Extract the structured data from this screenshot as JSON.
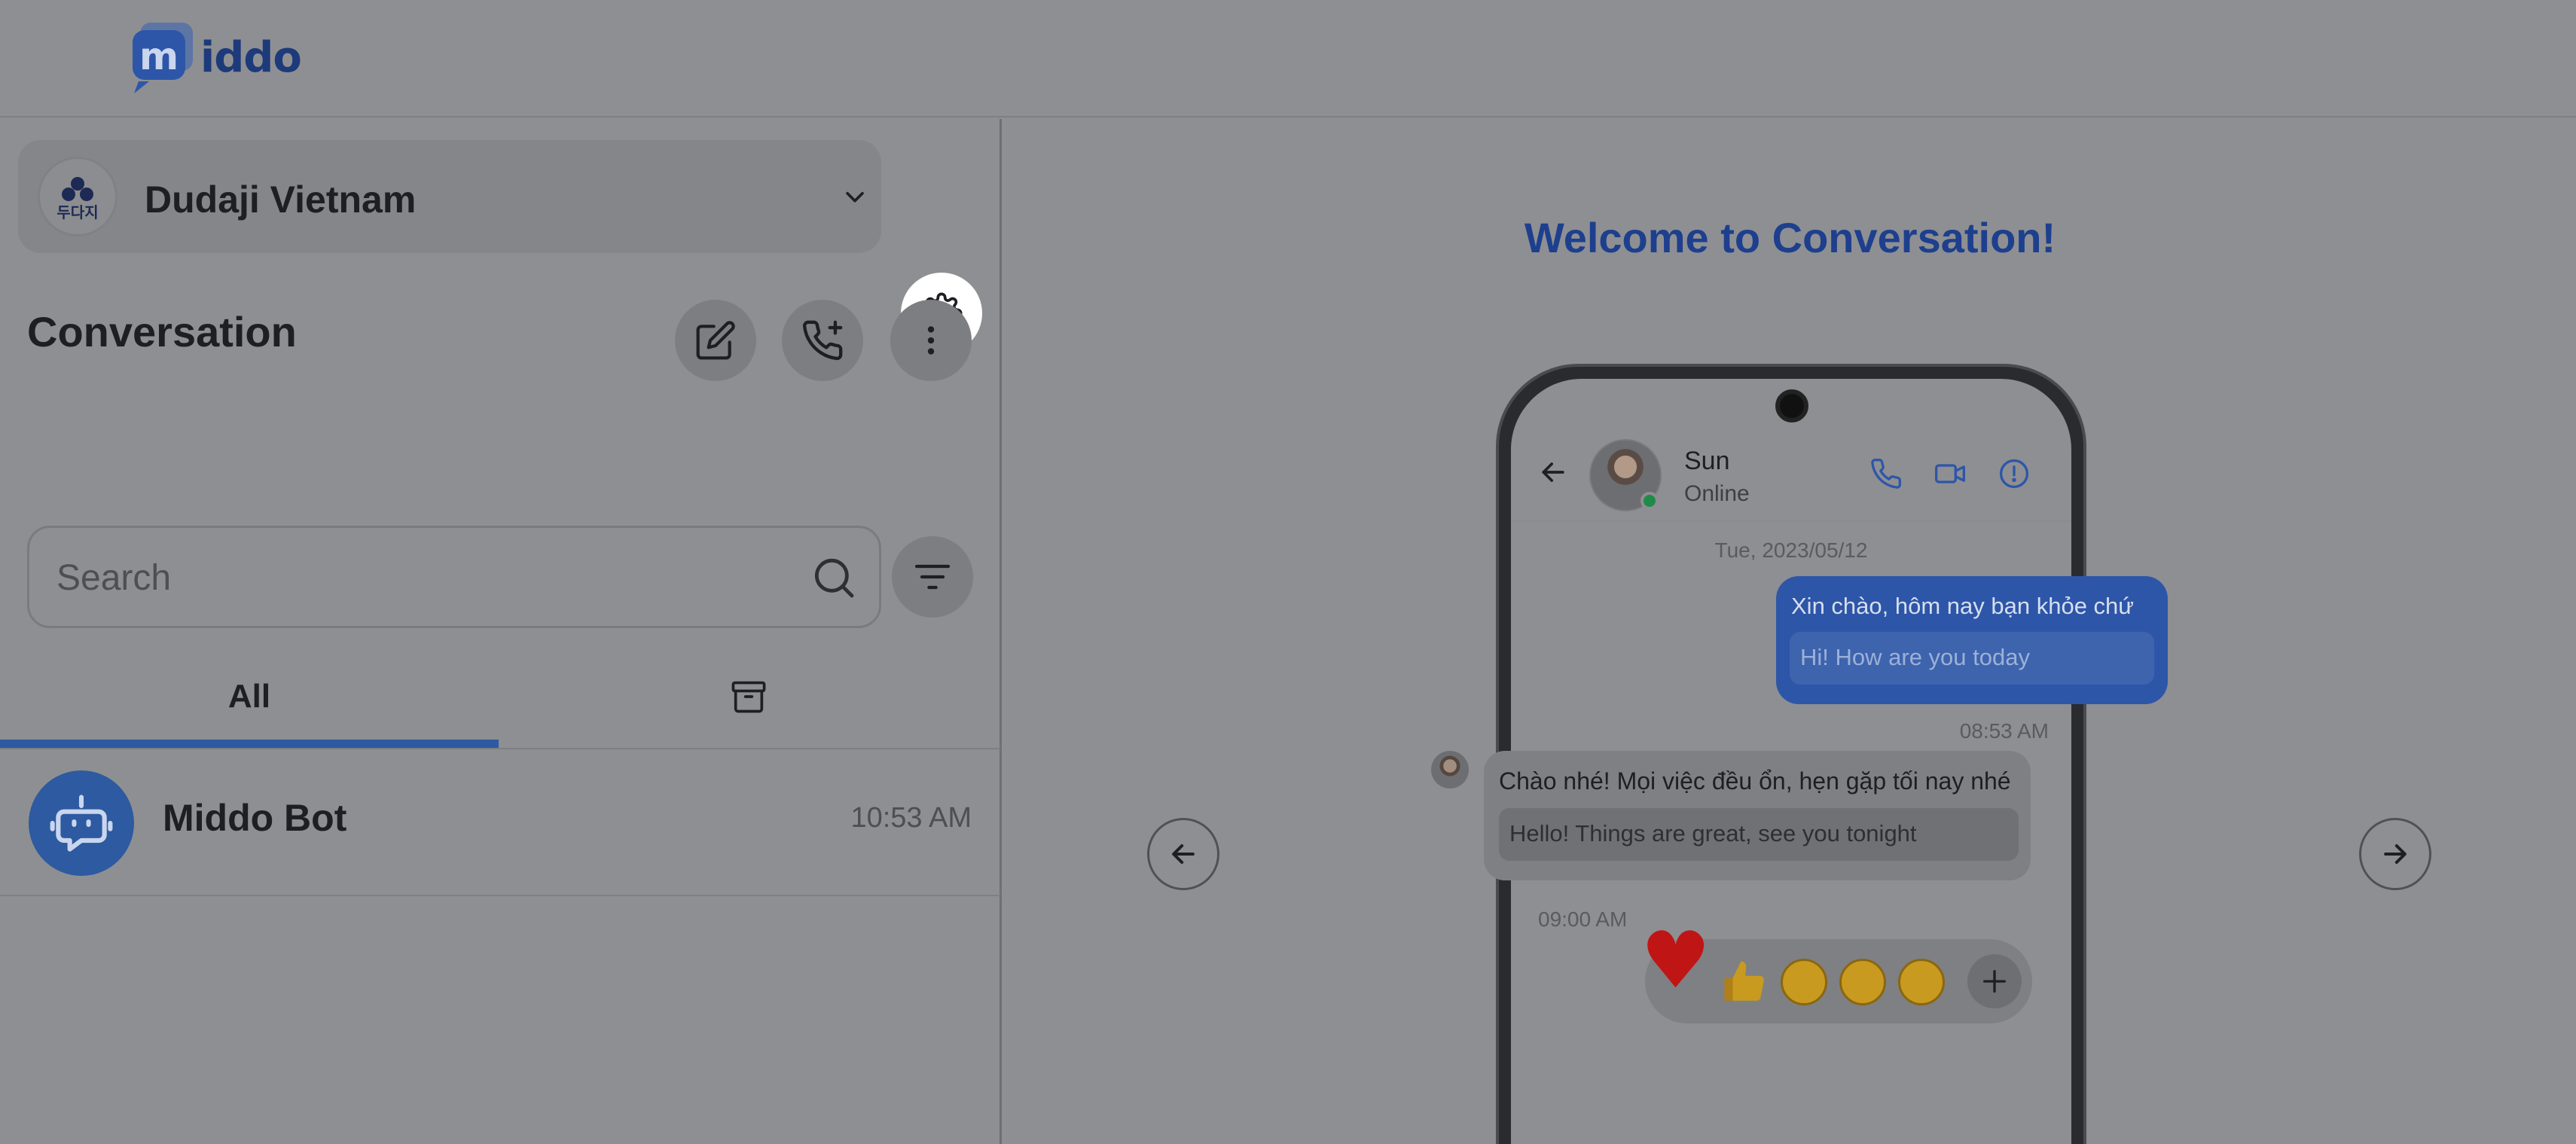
{
  "app": {
    "logo_text": "iddo",
    "logo_mark": "m"
  },
  "workspace": {
    "name": "Dudaji Vietnam",
    "avatar_text": "두다지"
  },
  "sidebar": {
    "title": "Conversation",
    "search": {
      "placeholder": "Search",
      "value": ""
    },
    "tabs": [
      {
        "label": "All",
        "active": true
      },
      {
        "icon": "archive-icon",
        "active": false
      }
    ],
    "conversations": [
      {
        "name": "Middo Bot",
        "time": "10:53 AM",
        "avatar_icon": "bot-icon"
      }
    ]
  },
  "main": {
    "welcome_title": "Welcome to Conversation!",
    "preview": {
      "contact_name": "Sun",
      "contact_status": "Online",
      "date_separator": "Tue, 2023/05/12",
      "outgoing": {
        "text": "Xin chào, hôm nay bạn khỏe chứ",
        "translation": "Hi! How are you today",
        "time": "08:53 AM"
      },
      "incoming": {
        "text": "Chào nhé! Mọi việc đều ổn, hẹn gặp tối nay nhé",
        "translation": "Hello! Things are great, see you tonight",
        "time": "09:00 AM"
      },
      "reactions": [
        "heart-icon",
        "thumbs-up-icon",
        "grinning-face-icon",
        "laughing-face-icon",
        "crying-face-icon",
        "plus-icon"
      ]
    }
  },
  "colors": {
    "accent": "#2d5aa0",
    "welcome_title": "#1d3f8e",
    "overlay_background": "#8e8f92",
    "settings_highlight": "#ffffff"
  }
}
